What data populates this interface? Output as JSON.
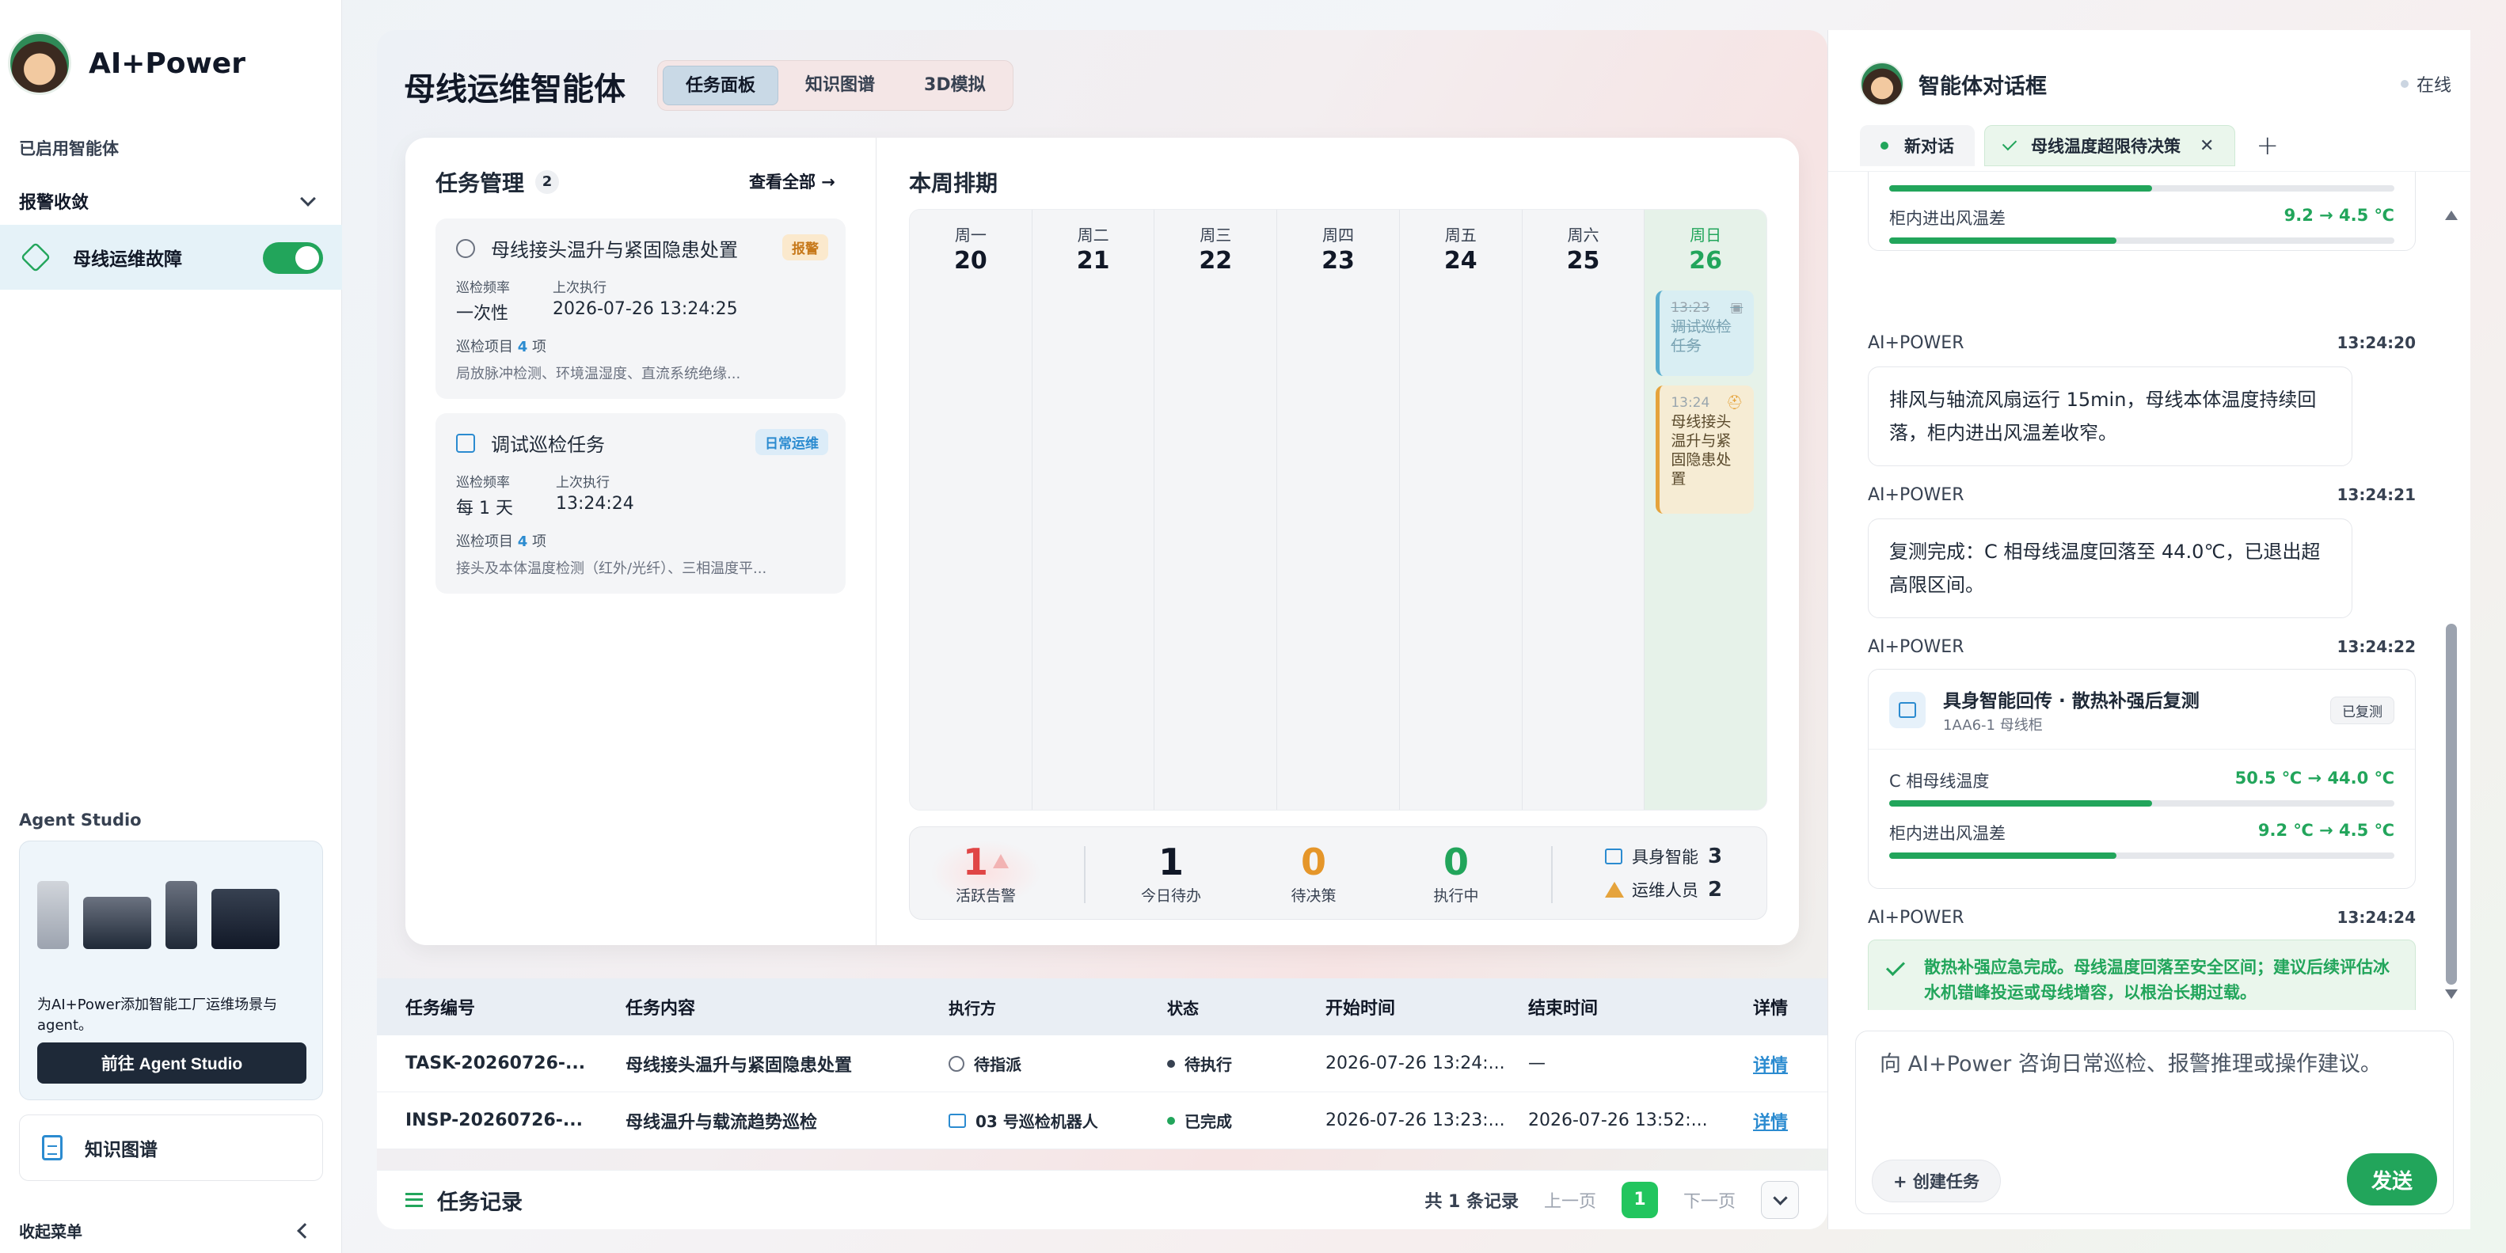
{
  "sidebar": {
    "brand": "AI+Power",
    "enabled_caption": "已启用智能体",
    "group_label": "报警收敛",
    "active_item": "母线运维故障",
    "studio_title": "Agent Studio",
    "studio_desc": "为AI+Power添加智能工厂运维场景与agent。",
    "studio_button": "前往 Agent Studio",
    "kg_label": "知识图谱",
    "collapse_label": "收起菜单"
  },
  "header": {
    "title": "母线运维智能体",
    "tabs": [
      "任务面板",
      "知识图谱",
      "3D模拟"
    ],
    "active_tab": "任务面板"
  },
  "tasks": {
    "title": "任务管理",
    "count": "2",
    "view_all": "查看全部 →",
    "cards": [
      {
        "title": "母线接头温升与紧固隐患处置",
        "tag": "报警",
        "freq_label": "巡检频率",
        "freq": "一次性",
        "last_label": "上次执行",
        "last": "2026-07-26 13:24:25",
        "items_prefix": "巡检项目",
        "items_count": "4",
        "items_suffix": "项",
        "desc": "局放脉冲检测、环境温湿度、直流系统绝缘..."
      },
      {
        "title": "调试巡检任务",
        "tag": "日常运维",
        "freq_label": "巡检频率",
        "freq": "每 1 天",
        "last_label": "上次执行",
        "last": "13:24:24",
        "items_prefix": "巡检项目",
        "items_count": "4",
        "items_suffix": "项",
        "desc": "接头及本体温度检测（红外/光纤）、三相温度平..."
      }
    ]
  },
  "schedule": {
    "title": "本周排期",
    "days": [
      {
        "name": "周一",
        "num": "20"
      },
      {
        "name": "周二",
        "num": "21"
      },
      {
        "name": "周三",
        "num": "22"
      },
      {
        "name": "周四",
        "num": "23"
      },
      {
        "name": "周五",
        "num": "24"
      },
      {
        "name": "周六",
        "num": "25"
      },
      {
        "name": "周日",
        "num": "26"
      }
    ],
    "events": [
      {
        "time": "13:23",
        "title": "调试巡检任务",
        "done": true
      },
      {
        "time": "13:24",
        "title": "母线接头温升与紧固隐患处置",
        "done": false
      }
    ]
  },
  "stats": {
    "alerts": {
      "value": "1",
      "label": "活跃告警",
      "color": "#e04545"
    },
    "todo": {
      "value": "1",
      "label": "今日待办",
      "color": "#111827"
    },
    "pending": {
      "value": "0",
      "label": "待决策",
      "color": "#e5962a"
    },
    "running": {
      "value": "0",
      "label": "执行中",
      "color": "#22a55b"
    },
    "robots": {
      "label": "具身智能",
      "value": "3"
    },
    "staff": {
      "label": "运维人员",
      "value": "2"
    }
  },
  "table": {
    "headers": [
      "任务编号",
      "任务内容",
      "执行方",
      "状态",
      "开始时间",
      "结束时间",
      "详情"
    ],
    "rows": [
      {
        "id": "TASK-20260726-...",
        "content": "母线接头温升与紧固隐患处置",
        "exec": "待指派",
        "status": "待执行",
        "status_color": "#374151",
        "start": "2026-07-26 13:24:...",
        "end": "—",
        "detail": "详情"
      },
      {
        "id": "INSP-20260726-...",
        "content": "母线温升与载流趋势巡检",
        "exec": "03 号巡检机器人",
        "status": "已完成",
        "status_color": "#22a55b",
        "start": "2026-07-26 13:23:...",
        "end": "2026-07-26 13:52:...",
        "detail": "详情"
      }
    ],
    "footer_title": "任务记录",
    "total": "共 1 条记录",
    "prev": "上一页",
    "page": "1",
    "next": "下一页"
  },
  "chat": {
    "title": "智能体对话框",
    "status": "在线",
    "tabs": [
      "新对话",
      "母线温度超限待决策"
    ],
    "top_card": {
      "metric_label": "柜内进出风温差",
      "metric_value": "9.2 → 4.5 ℃",
      "fill_prev": 0.52,
      "fill": 0.45
    },
    "messages": [
      {
        "sender": "AI+POWER",
        "time": "13:24:20",
        "text": "排风与轴流风扇运行 15min，母线本体温度持续回落，柜内进出风温差收窄。"
      },
      {
        "sender": "AI+POWER",
        "time": "13:24:21",
        "text": "复测完成：C 相母线温度回落至 44.0℃，已退出超高限区间。"
      }
    ],
    "embodied": {
      "sender": "AI+POWER",
      "time": "13:24:22",
      "title": "具身智能回传 · 散热补强后复测",
      "subtitle": "1AA6-1 母线柜",
      "tag": "已复测",
      "metrics": [
        {
          "label": "C 相母线温度",
          "value": "50.5 ℃ → 44.0 ℃",
          "fill": 0.52
        },
        {
          "label": "柜内进出风温差",
          "value": "9.2 ℃ → 4.5 ℃",
          "fill": 0.45
        }
      ]
    },
    "final": {
      "sender": "AI+POWER",
      "time": "13:24:24",
      "text": "散热补强应急完成。母线温度回落至安全区间；建议后续评估冰水机错峰投运或母线增容，以根治长期过载。"
    },
    "input_placeholder": "向 AI+Power 咨询日常巡检、报警推理或操作建议。",
    "create_task": "+ 创建任务",
    "send": "发送"
  }
}
